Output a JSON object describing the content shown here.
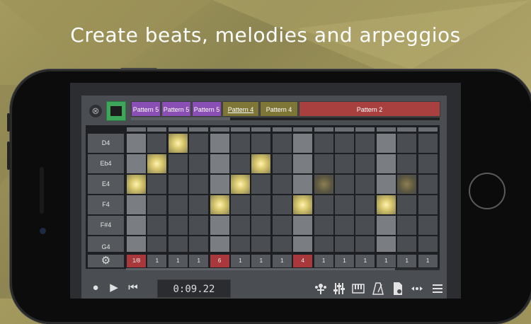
{
  "headline": "Create beats, melodies and arpeggios",
  "toolbar": {
    "close_icon": "⊗",
    "patterns": [
      {
        "label": "Pattern 5",
        "color": "purple"
      },
      {
        "label": "Pattern 5",
        "color": "purple"
      },
      {
        "label": "Pattern 5",
        "color": "purple"
      },
      {
        "label": "Pattern 4",
        "color": "olive",
        "selected": true
      },
      {
        "label": "Pattern 4",
        "color": "olive"
      },
      {
        "label": "Pattern 2",
        "color": "red"
      }
    ]
  },
  "notes": [
    "D4",
    "Eb4",
    "E4",
    "F4",
    "F#4",
    "G4"
  ],
  "settings_icon": "⚙",
  "steps": [
    "1/8",
    "1",
    "1",
    "1",
    "6",
    "1",
    "1",
    "1",
    "4",
    "1",
    "1",
    "1",
    "1",
    "1",
    "1"
  ],
  "active_cells": [
    [
      0,
      2
    ],
    [
      1,
      1
    ],
    [
      1,
      6
    ],
    [
      2,
      0
    ],
    [
      2,
      5
    ],
    [
      3,
      4
    ],
    [
      3,
      8
    ],
    [
      3,
      12
    ]
  ],
  "dim_cells": [
    [
      2,
      9
    ],
    [
      2,
      13
    ]
  ],
  "transport": {
    "record_icon": "●",
    "play_icon": "▶",
    "rewind_icon": "⏮",
    "time": "0:09.22"
  },
  "colors": {
    "accent_green": "#3ea55a",
    "pattern_purple": "#8a4fb4",
    "pattern_olive": "#7e7636",
    "pattern_red": "#a8403f",
    "active_cell": "#d9c86e",
    "step_red": "#a8383b"
  }
}
